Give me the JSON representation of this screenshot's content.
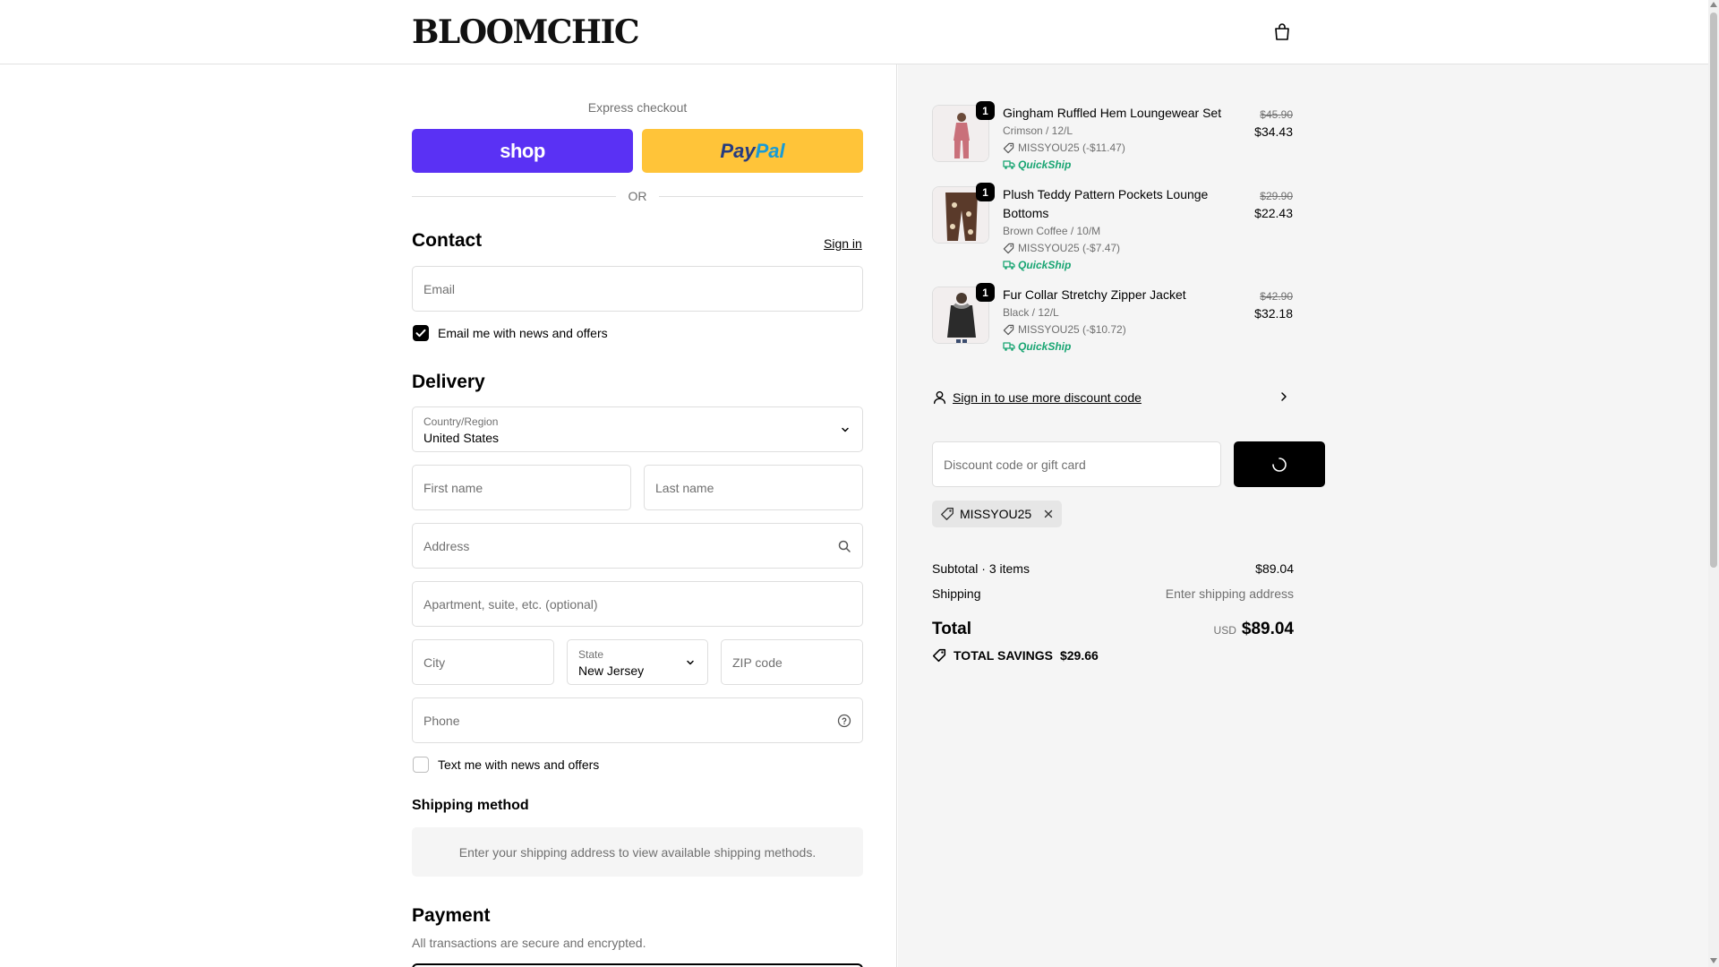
{
  "header": {
    "logo": "BLOOMCHIC",
    "cart_icon": "shopping-bag-icon"
  },
  "express": {
    "label": "Express checkout",
    "shop_label": "shop",
    "paypal_label_1": "Pay",
    "paypal_label_2": "Pal",
    "or_label": "OR"
  },
  "contact": {
    "title": "Contact",
    "signin_link": "Sign in",
    "email_placeholder": "Email",
    "email_news_label": "Email me with news and offers",
    "email_news_checked": true
  },
  "delivery": {
    "title": "Delivery",
    "country_label": "Country/Region",
    "country_value": "United States",
    "first_name_placeholder": "First name",
    "last_name_placeholder": "Last name",
    "address_placeholder": "Address",
    "apartment_placeholder": "Apartment, suite, etc. (optional)",
    "city_placeholder": "City",
    "state_label": "State",
    "state_value": "New Jersey",
    "zip_placeholder": "ZIP code",
    "phone_placeholder": "Phone",
    "text_news_label": "Text me with news and offers",
    "text_news_checked": false
  },
  "shipping_method": {
    "title": "Shipping method",
    "message": "Enter your shipping address to view available shipping methods."
  },
  "payment": {
    "title": "Payment",
    "subtitle": "All transactions are secure and encrypted."
  },
  "order": {
    "items": [
      {
        "qty": "1",
        "name": "Gingham Ruffled Hem Loungewear Set",
        "name2": "",
        "variant": "Crimson / 12/L",
        "discount": "MISSYOU25 (-$11.47)",
        "quickship": "QuickShip",
        "original_price": "$45.90",
        "price": "$34.43",
        "thumb_color": "#c9707a"
      },
      {
        "qty": "1",
        "name": "Plush Teddy Pattern Pockets Lounge",
        "name2": "Bottoms",
        "variant": "Brown Coffee / 10/M",
        "discount": "MISSYOU25 (-$7.47)",
        "quickship": "QuickShip",
        "original_price": "$29.90",
        "price": "$22.43",
        "thumb_color": "#5a3a2a"
      },
      {
        "qty": "1",
        "name": "Fur Collar Stretchy Zipper Jacket",
        "name2": "",
        "variant": "Black / 12/L",
        "discount": "MISSYOU25 (-$10.72)",
        "quickship": "QuickShip",
        "original_price": "$42.90",
        "price": "$32.18",
        "thumb_color": "#2b2b2b"
      }
    ],
    "signin_discount": "Sign in to use more discount code",
    "discount_placeholder": "Discount code or gift card",
    "applied_code": "MISSYOU25",
    "subtotal_label": "Subtotal · 3 items",
    "subtotal_value": "$89.04",
    "shipping_label": "Shipping",
    "shipping_value": "Enter shipping address",
    "total_label": "Total",
    "total_currency": "USD",
    "total_value": "$89.04",
    "savings_label": "TOTAL SAVINGS",
    "savings_value": "$29.66"
  },
  "colors": {
    "shop": "#5a31f4",
    "paypal": "#ffc439",
    "quickship": "#18a572"
  }
}
